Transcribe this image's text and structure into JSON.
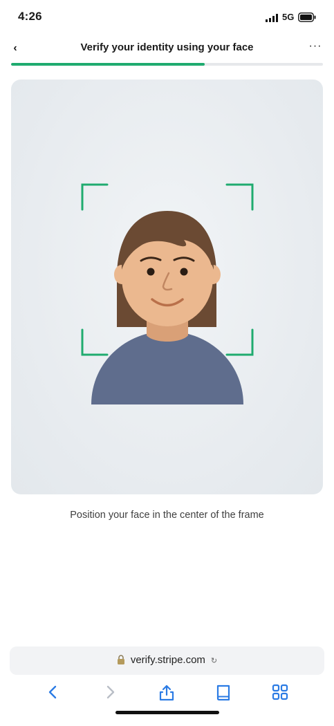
{
  "status_bar": {
    "time": "4:26",
    "network": "5G"
  },
  "header": {
    "back_label": "‹",
    "title": "Verify your identity using your face",
    "more_label": "···",
    "progress_fraction": 0.62
  },
  "camera": {
    "frame_color": "#1fab6f",
    "skin_color": "#ebb88f",
    "hair_color": "#6b4a33",
    "shirt_color": "#5f6d8d"
  },
  "instruction": "Position your face in the center of the frame",
  "browser": {
    "url": "verify.stripe.com",
    "reload_label": "↻",
    "accent_color": "#2b7be4",
    "toolbar": [
      "back-icon",
      "forward-icon",
      "share-icon",
      "bookmarks-icon",
      "tabs-icon"
    ]
  }
}
